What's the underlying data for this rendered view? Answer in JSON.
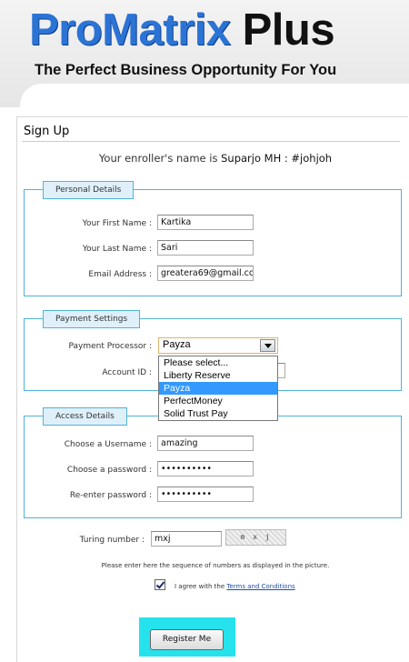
{
  "header": {
    "logo_part1": "ProMatrix",
    "logo_part2": " Plus",
    "tagline": "The Perfect Business Opportunity For You"
  },
  "page": {
    "title": "Sign Up",
    "enroller_prefix": "Your enroller's name is ",
    "enroller_name": "Suparjo MH : #johjoh"
  },
  "personal": {
    "legend": "Personal Details",
    "first_name_label": "Your First Name :",
    "first_name_value": "Kartika",
    "last_name_label": "Your Last Name :",
    "last_name_value": "Sari",
    "email_label": "Email Address :",
    "email_value": "greatera69@gmail.cc"
  },
  "payment": {
    "legend": "Payment Settings",
    "processor_label": "Payment Processor :",
    "processor_value": "Payza",
    "account_label": "Account ID :",
    "options": [
      "Please select...",
      "Liberty Reserve",
      "Payza",
      "PerfectMoney",
      "Solid Trust Pay"
    ],
    "selected_index": 2
  },
  "access": {
    "legend": "Access Details",
    "username_label": "Choose a Username :",
    "username_value": "amazing",
    "password_label": "Choose a password :",
    "password_value": "••••••••••",
    "reenter_label": "Re-enter password :",
    "reenter_value": "••••••••••"
  },
  "turing": {
    "label": "Turing number :",
    "value": "mxj",
    "image_text": "m x j",
    "instruction": "Please enter here the sequence of numbers as displayed in the picture."
  },
  "agree": {
    "checked": true,
    "text": "I agree with the ",
    "link": "Terms and Conditions"
  },
  "register_label": "Register Me",
  "colors": {
    "brand_blue": "#2b74d6",
    "fieldset_border": "#4fb3d9",
    "legend_bg": "#dff0fa",
    "highlight_cyan": "#26e2ec",
    "selected_option": "#3399ff"
  }
}
